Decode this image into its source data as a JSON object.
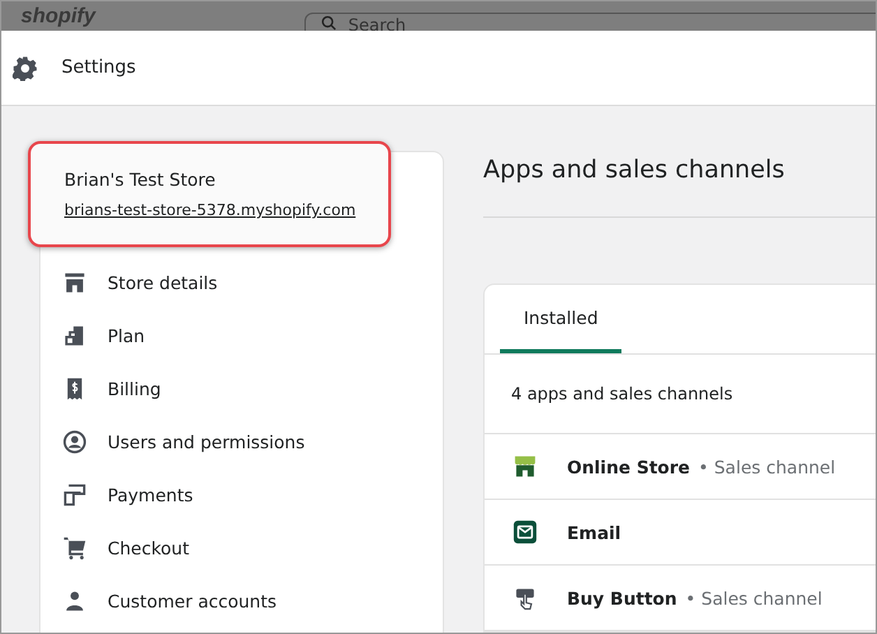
{
  "top_bar": {
    "logo": "shopify",
    "search": {
      "placeholder": "Search"
    }
  },
  "header": {
    "title": "Settings"
  },
  "store": {
    "name": "Brian's Test Store",
    "url": "brians-test-store-5378.myshopify.com",
    "highlighted": true
  },
  "nav": [
    {
      "label": "Store details"
    },
    {
      "label": "Plan"
    },
    {
      "label": "Billing"
    },
    {
      "label": "Users and permissions"
    },
    {
      "label": "Payments"
    },
    {
      "label": "Checkout"
    },
    {
      "label": "Customer accounts"
    }
  ],
  "main": {
    "title": "Apps and sales channels",
    "tabs": [
      {
        "label": "Installed",
        "selected": true
      }
    ],
    "count": "4 apps and sales channels",
    "apps": [
      {
        "name": "Online Store",
        "type": "• Sales channel"
      },
      {
        "name": "Email"
      },
      {
        "name": "Buy Button",
        "type": "• Sales channel"
      }
    ]
  }
}
